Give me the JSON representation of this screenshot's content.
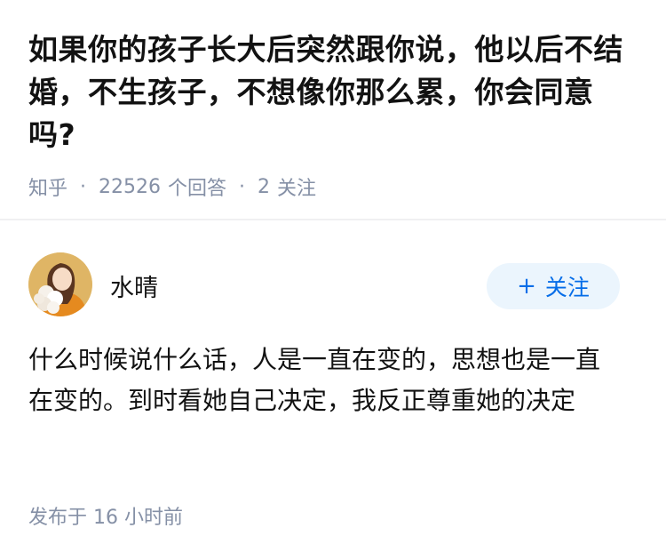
{
  "question": {
    "title": "如果你的孩子长大后突然跟你说，他以后不结婚，不生孩子，不想像你那么累，你会同意吗?",
    "source": "知乎",
    "answer_count": "22526",
    "answer_label": "个回答",
    "follow_count": "2",
    "follow_label": "关注"
  },
  "answer": {
    "author_name": "水晴",
    "follow_button_label": "关注",
    "body": "什么时候说什么话，人是一直在变的，思想也是一直在变的。到时看她自己决定，我反正尊重她的决定",
    "publish_time": "发布于 16 小时前"
  },
  "colors": {
    "meta_gray": "#8590a6",
    "accent_blue": "#056de8",
    "follow_bg": "#ebf5fd"
  },
  "icons": {
    "follow": "plus-icon",
    "avatar": "avatar-photo"
  }
}
